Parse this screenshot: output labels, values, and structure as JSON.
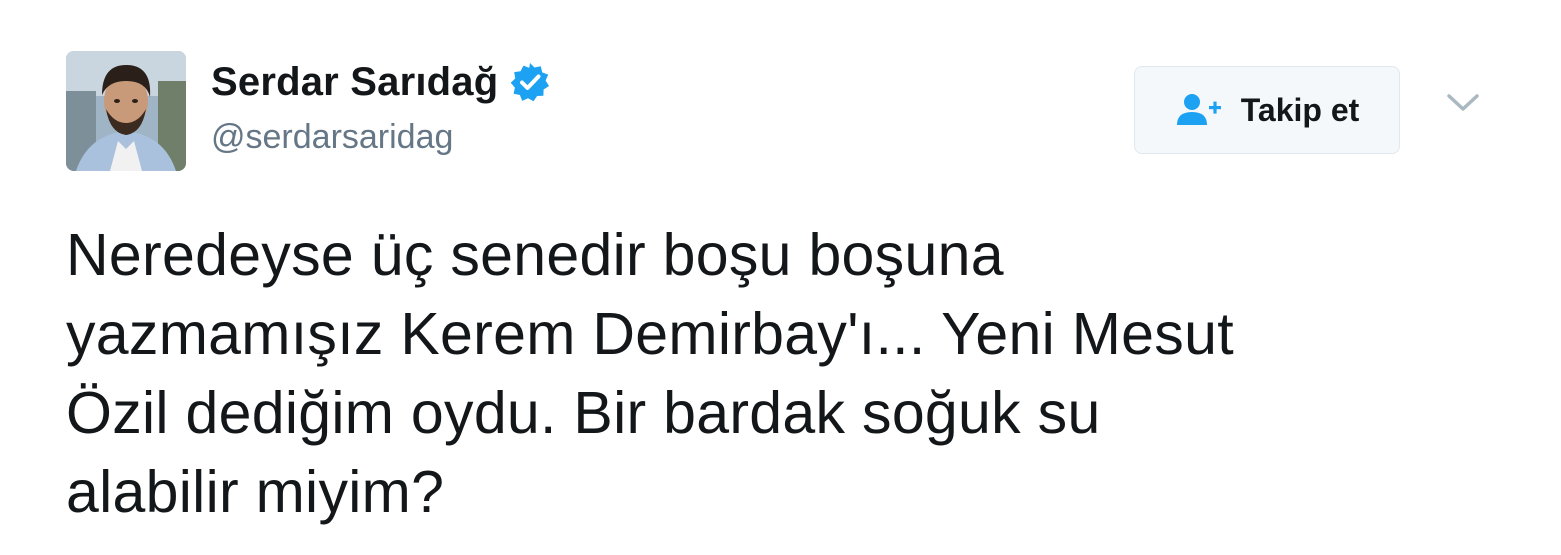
{
  "user": {
    "full_name": "Serdar Sarıdağ",
    "handle": "@serdarsaridag",
    "verified": true,
    "avatar_icon": "profile-photo"
  },
  "follow_button": {
    "label": "Takip et",
    "icon": "add-user-icon"
  },
  "menu": {
    "icon": "chevron-down-icon"
  },
  "tweet": {
    "lines": [
      "Neredeyse üç senedir boşu boşuna",
      "yazmamışız Kerem Demirbay'ı... Yeni Mesut",
      "Özil dediğim oydu. Bir bardak soğuk su",
      "alabilir miyim?"
    ]
  },
  "colors": {
    "verified_blue": "#1da1f2",
    "follow_icon_blue": "#1da1f2",
    "text": "#14171a",
    "muted": "#657786",
    "button_bg": "#f5f8fa",
    "button_border": "#e1e8ed"
  }
}
